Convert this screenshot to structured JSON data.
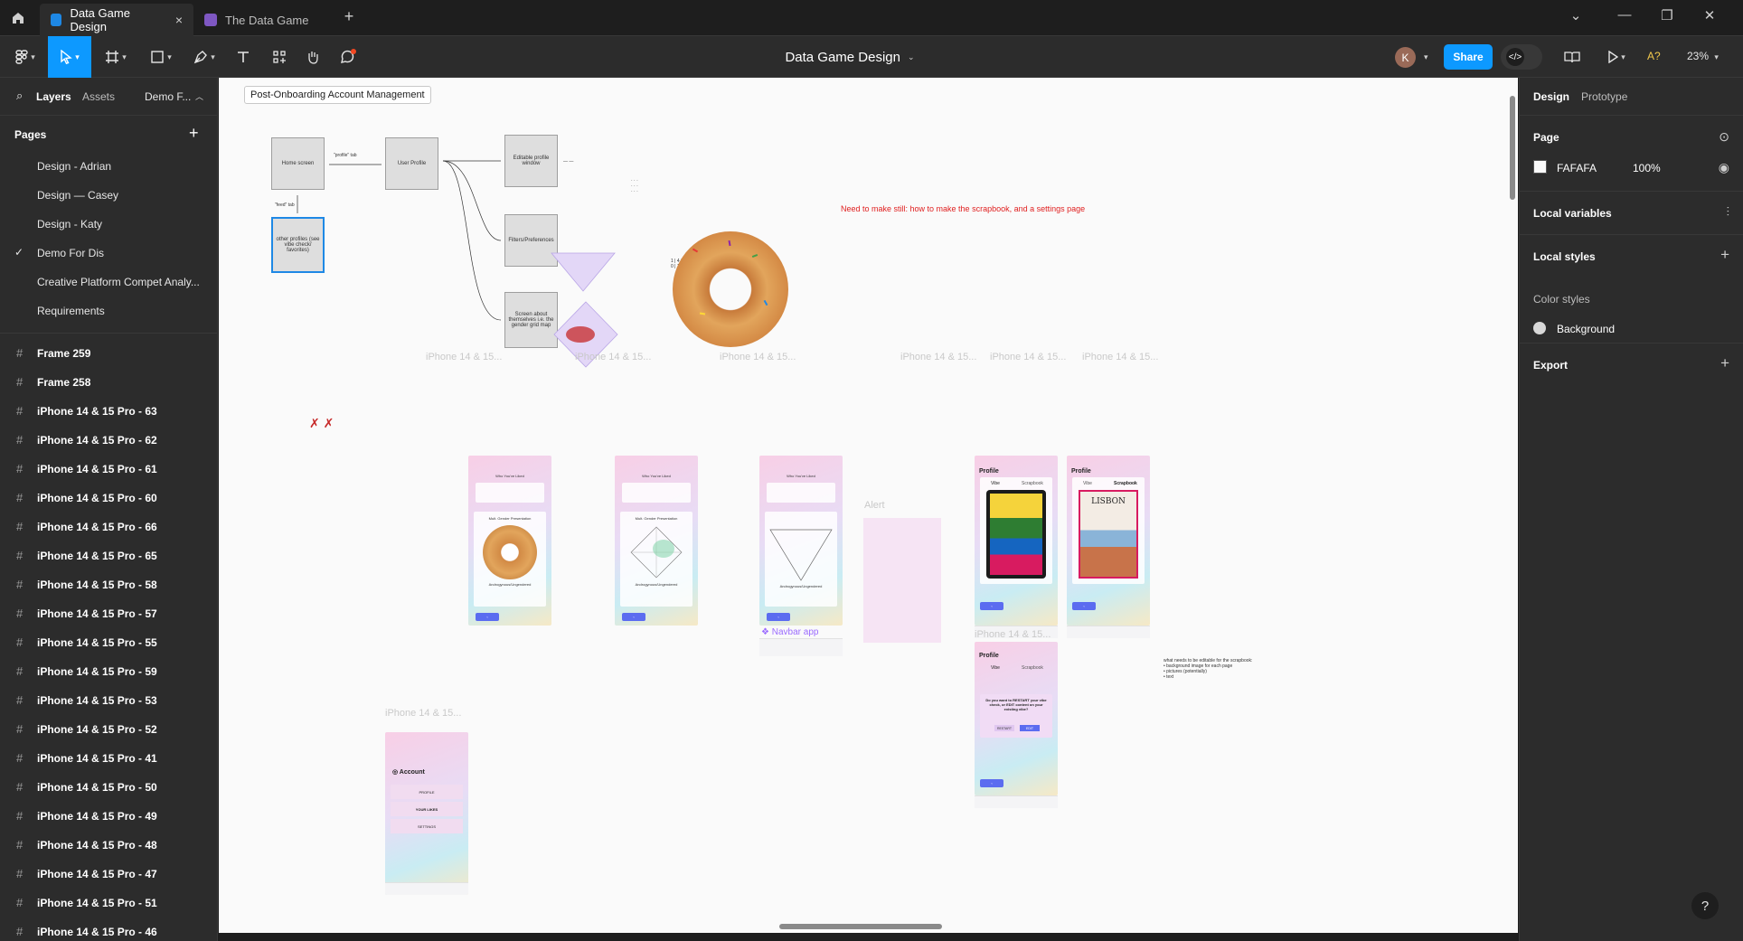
{
  "titlebar": {
    "tabs": [
      {
        "label": "Data Game Design",
        "active": true
      },
      {
        "label": "The Data Game",
        "active": false
      }
    ]
  },
  "toolbar": {
    "doc_title": "Data Game Design",
    "user_initial": "K",
    "share_label": "Share",
    "ai_label": "A?",
    "zoom": "23%"
  },
  "left_panel": {
    "tabs": [
      "Layers",
      "Assets"
    ],
    "page_switcher": "Demo F...",
    "pages_heading": "Pages",
    "pages": [
      "Design - Adrian",
      "Design — Casey",
      "Design - Katy",
      "Demo For Dis",
      "Creative Platform Compet Analy...",
      "Requirements"
    ],
    "current_page": "Demo For Dis",
    "layers": [
      "Frame 259",
      "Frame 258",
      "iPhone 14 & 15 Pro - 63",
      "iPhone 14 & 15 Pro - 62",
      "iPhone 14 & 15 Pro - 61",
      "iPhone 14 & 15 Pro - 60",
      "iPhone 14 & 15 Pro - 66",
      "iPhone 14 & 15 Pro - 65",
      "iPhone 14 & 15 Pro - 58",
      "iPhone 14 & 15 Pro - 57",
      "iPhone 14 & 15 Pro - 55",
      "iPhone 14 & 15 Pro - 59",
      "iPhone 14 & 15 Pro - 53",
      "iPhone 14 & 15 Pro - 52",
      "iPhone 14 & 15 Pro - 41",
      "iPhone 14 & 15 Pro - 50",
      "iPhone 14 & 15 Pro - 49",
      "iPhone 14 & 15 Pro - 48",
      "iPhone 14 & 15 Pro - 47",
      "iPhone 14 & 15 Pro - 51",
      "iPhone 14 & 15 Pro - 46"
    ]
  },
  "right_panel": {
    "tabs": [
      "Design",
      "Prototype"
    ],
    "page_heading": "Page",
    "page_fill_hex": "FAFAFA",
    "page_fill_opacity": "100%",
    "local_variables": "Local variables",
    "local_styles": "Local styles",
    "color_styles": "Color styles",
    "color_style_name": "Background",
    "export": "Export"
  },
  "canvas": {
    "frame_label": "Post-Onboarding Account Management",
    "flow": {
      "home": "Home screen",
      "profile_tab": "\"profile\" tab",
      "user_profile": "User Profile",
      "editable": "Editable profile window",
      "filters": "Filters/Preferences",
      "about": "Screen about themselves i.e. the gender grid map",
      "feed_tab": "\"feed\" tab",
      "other_profiles": "other profiles (see vibe check/ favorites)"
    },
    "red_note": "Need to make still: how to make the scrapbook, and a settings page",
    "phone_label": "iPhone 14 & 15...",
    "alert_label": "Alert",
    "navbar_label": "Navbar app",
    "profile_title": "Profile",
    "vibe_tab": "Vibe",
    "scrapbook_tab": "Scrapbook",
    "lisbon": "LISBON",
    "account_title": "Account",
    "account_items": [
      "PROFILE",
      "YOUR LIKES",
      "SETTINGS"
    ],
    "restart_prompt": "Do you want to RESTART your vibe check, or EDIT content on your existing vibe?",
    "restart_btn": "RESTART",
    "edit_btn": "EDIT",
    "scrapbook_note": "what needs to be editable for the scrapbook:",
    "scrapbook_items": [
      "background image for each page",
      "pictures (potentially)",
      "text"
    ],
    "presentation_labels": [
      "Mult. Gender Presentation",
      "Androgynous/Ungendered"
    ],
    "vibe_heading": "Who You've Liked"
  },
  "colors": {
    "accent": "#0d99ff",
    "panel": "#2c2c2c",
    "canvas_bg": "#1e1e1e",
    "board": "#fafafa",
    "red_note": "#e02020",
    "phone_button": "#5b6cf0"
  }
}
